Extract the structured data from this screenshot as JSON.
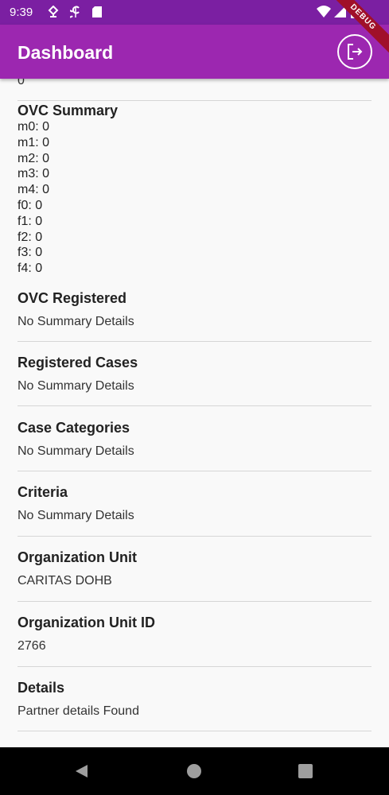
{
  "status_bar": {
    "time": "9:39",
    "left_icons": [
      "location-icon",
      "sim-icon",
      "sd-card-icon"
    ],
    "right_icons": [
      "wifi-icon",
      "signal-icon",
      "battery-icon"
    ]
  },
  "app_bar": {
    "title": "Dashboard",
    "logout_icon": "logout-icon",
    "debug_label": "DEBUG"
  },
  "top_value": "0",
  "ovc_summary": {
    "title": "OVC Summary",
    "items": [
      {
        "key": "m0",
        "value": "0"
      },
      {
        "key": "m1",
        "value": "0"
      },
      {
        "key": "m2",
        "value": "0"
      },
      {
        "key": "m3",
        "value": "0"
      },
      {
        "key": "m4",
        "value": "0"
      },
      {
        "key": "f0",
        "value": "0"
      },
      {
        "key": "f1",
        "value": "0"
      },
      {
        "key": "f2",
        "value": "0"
      },
      {
        "key": "f3",
        "value": "0"
      },
      {
        "key": "f4",
        "value": "0"
      }
    ]
  },
  "sections": [
    {
      "title": "OVC Registered",
      "value": "No Summary Details"
    },
    {
      "title": "Registered Cases",
      "value": "No Summary Details"
    },
    {
      "title": "Case Categories",
      "value": "No Summary Details"
    },
    {
      "title": "Criteria",
      "value": "No Summary Details"
    },
    {
      "title": "Organization Unit",
      "value": "CARITAS DOHB"
    },
    {
      "title": "Organization Unit ID",
      "value": "2766"
    },
    {
      "title": "Details",
      "value": "Partner details Found"
    }
  ],
  "nav_bar": {
    "buttons": [
      "back-icon",
      "home-icon",
      "recents-icon"
    ]
  }
}
